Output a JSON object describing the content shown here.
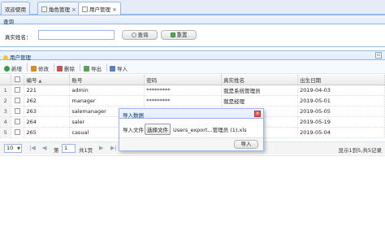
{
  "tabs": [
    {
      "label": "欢迎使用",
      "closable": false
    },
    {
      "label": "角色管理",
      "closable": true
    },
    {
      "label": "用户管理",
      "closable": true
    }
  ],
  "search_panel": {
    "title": "查询",
    "label": "真实姓名：",
    "input_value": "",
    "search_label": "查询",
    "reset_label": "重置"
  },
  "grid_panel": {
    "title": "用户管理",
    "collapse_icon": "collapse-icon"
  },
  "toolbar": {
    "add": "新增",
    "edit": "修改",
    "delete": "删除",
    "export": "导出",
    "import": "导入"
  },
  "table": {
    "headers": [
      "编号",
      "账号",
      "密码",
      "真实姓名",
      "出生日期"
    ],
    "sort_indicator": "▲",
    "rows": [
      {
        "n": "1",
        "id": "221",
        "account": "admin",
        "password": "*********",
        "name": "我是系统管理员",
        "birth": "2019-04-03"
      },
      {
        "n": "2",
        "id": "262",
        "account": "manager",
        "password": "*********",
        "name": "我是经理",
        "birth": "2019-05-01"
      },
      {
        "n": "3",
        "id": "263",
        "account": "salemanager",
        "password": "",
        "name": "",
        "birth": "2019-05-05"
      },
      {
        "n": "4",
        "id": "264",
        "account": "saler",
        "password": "",
        "name": "",
        "birth": "2019-05-19"
      },
      {
        "n": "5",
        "id": "265",
        "account": "casual",
        "password": "",
        "name": "",
        "birth": "2019-05-04"
      }
    ]
  },
  "pager": {
    "page_size": "10",
    "prefix": "第",
    "page": "1",
    "total_pages": "共1页",
    "summary": "显示1到5,共5记录"
  },
  "dialog": {
    "title": "导入数据",
    "file_label": "导入文件",
    "choose_file": "选择文件",
    "file_name": "Users_export...管理员 (1).xls",
    "import_button": "导入"
  },
  "colors": {
    "border": "#95b8e7",
    "header_bg": "#e0ecff",
    "close_red": "#e05b4b"
  }
}
